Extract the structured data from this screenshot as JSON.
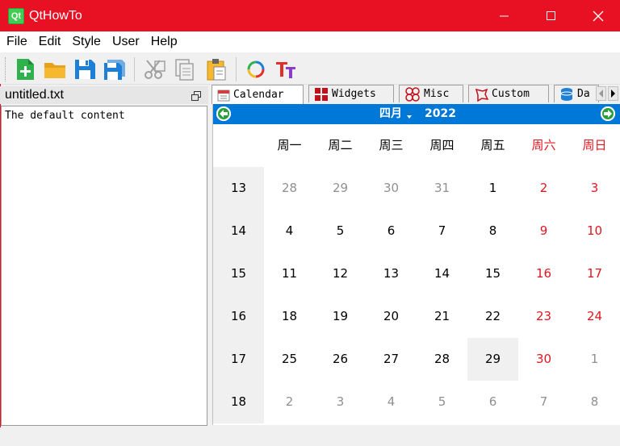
{
  "window": {
    "title": "QtHowTo",
    "icon_label": "Qt",
    "accent": "#e81123"
  },
  "menu": [
    {
      "label": "File"
    },
    {
      "label": "Edit"
    },
    {
      "label": "Style"
    },
    {
      "label": "User"
    },
    {
      "label": "Help"
    }
  ],
  "toolbar": {
    "icons": [
      "new-file-icon",
      "open-folder-icon",
      "save-icon",
      "save-all-icon",
      "cut-icon",
      "copy-icon",
      "paste-icon",
      "color-icon",
      "font-icon"
    ]
  },
  "dock": {
    "title": "untitled.txt",
    "content": "The default content"
  },
  "tabs": [
    {
      "label": "Calendar"
    },
    {
      "label": "Widgets"
    },
    {
      "label": "Misc"
    },
    {
      "label": "Custom"
    },
    {
      "label": "Da"
    }
  ],
  "calendar": {
    "month": "四月",
    "year": "2022",
    "nav_color": "#0078d7",
    "weekdays": [
      "周一",
      "周二",
      "周三",
      "周四",
      "周五",
      "周六",
      "周日"
    ],
    "weeks": [
      {
        "num": "13",
        "days": [
          "28",
          "29",
          "30",
          "31",
          "1",
          "2",
          "3"
        ]
      },
      {
        "num": "14",
        "days": [
          "4",
          "5",
          "6",
          "7",
          "8",
          "9",
          "10"
        ]
      },
      {
        "num": "15",
        "days": [
          "11",
          "12",
          "13",
          "14",
          "15",
          "16",
          "17"
        ]
      },
      {
        "num": "16",
        "days": [
          "18",
          "19",
          "20",
          "21",
          "22",
          "23",
          "24"
        ]
      },
      {
        "num": "17",
        "days": [
          "25",
          "26",
          "27",
          "28",
          "29",
          "30",
          "1"
        ]
      },
      {
        "num": "18",
        "days": [
          "2",
          "3",
          "4",
          "5",
          "6",
          "7",
          "8"
        ]
      }
    ],
    "selected": "29"
  }
}
